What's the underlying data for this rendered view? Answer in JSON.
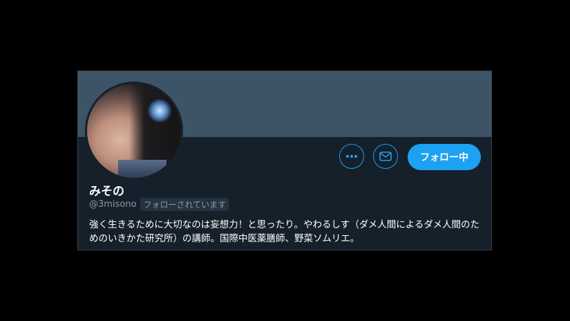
{
  "profile": {
    "display_name": "みその",
    "handle": "@3misono",
    "follows_you_label": "フォローされています",
    "bio": "強く生きるために大切なのは妄想力！と思ったり。やわるしす（ダメ人間によるダメ人間のためのいきかた研究所）の講師。国際中医薬膳師、野菜ソムリエ。"
  },
  "actions": {
    "more_icon": "more-icon",
    "message_icon": "envelope-icon",
    "follow_label": "フォロー中"
  },
  "colors": {
    "background": "#000000",
    "card": "#15202b",
    "banner": "#3d5466",
    "accent": "#1da1f2",
    "secondary_text": "#8899a6"
  }
}
